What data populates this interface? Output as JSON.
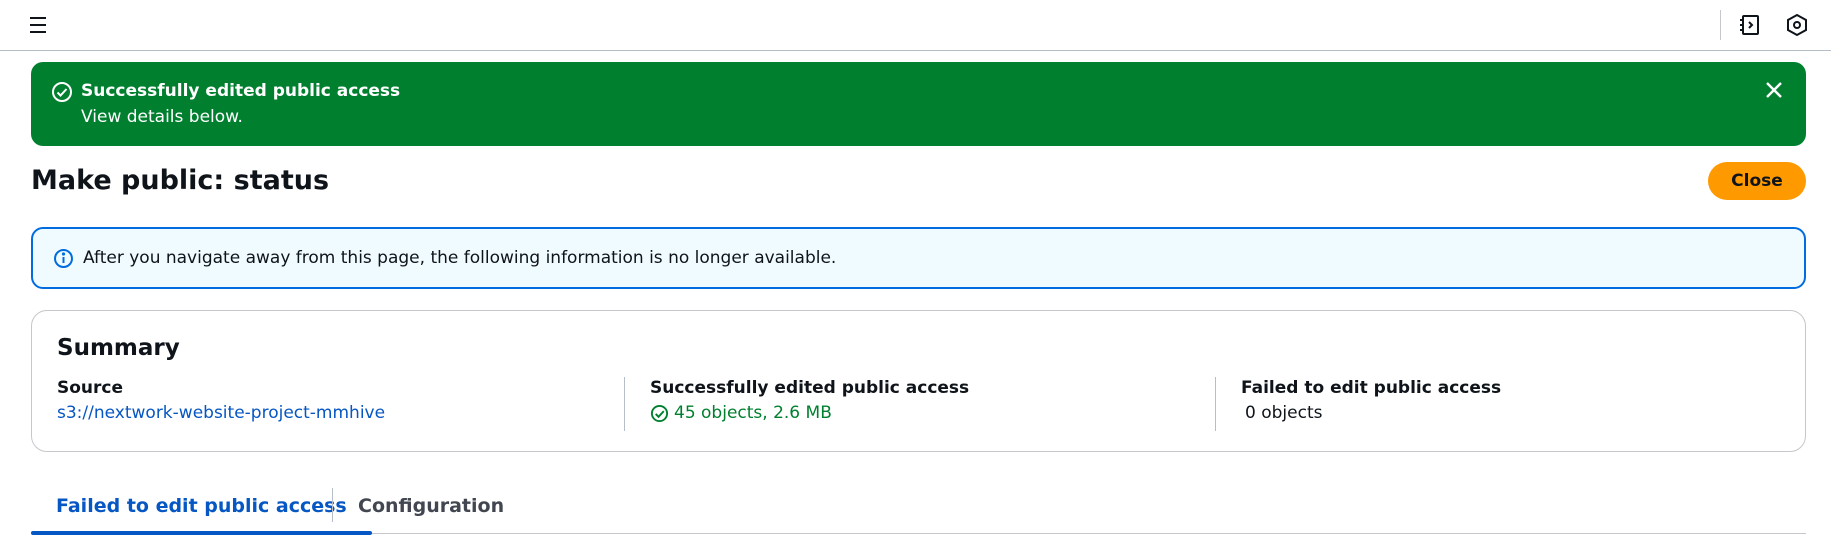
{
  "topbar": {
    "menu_icon": "hamburger-menu-icon",
    "right_icons": [
      "notes-icon",
      "hexagon-settings-icon"
    ]
  },
  "flash": {
    "title": "Successfully edited public access",
    "message": "View details below.",
    "color": "#00802f"
  },
  "header": {
    "title": "Make public: status",
    "close_label": "Close",
    "close_color": "#ff9900"
  },
  "info_alert": {
    "text": "After you navigate away from this page, the following information is no longer available."
  },
  "summary": {
    "heading": "Summary",
    "source_label": "Source",
    "source_value": "s3://nextwork-website-project-mmhive",
    "success_label": "Successfully edited public access",
    "success_value": "45 objects, 2.6 MB",
    "failed_label": "Failed to edit public access",
    "failed_value": "0 objects"
  },
  "tabs": [
    {
      "label": "Failed to edit public access",
      "active": true
    },
    {
      "label": "Configuration",
      "active": false
    }
  ],
  "colors": {
    "link": "#0656c3",
    "success": "#00802f",
    "info_border": "#006ce0"
  }
}
